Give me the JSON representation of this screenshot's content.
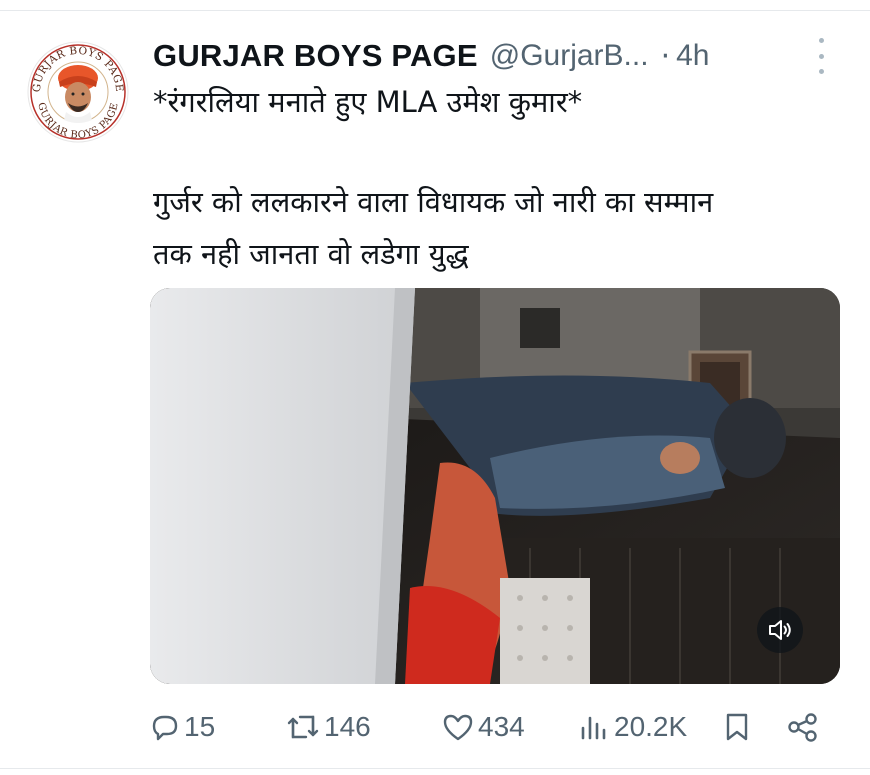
{
  "tweet": {
    "author_name": "GURJAR BOYS PAGE",
    "handle": "@GurjarB...",
    "separator": "·",
    "time": "4h",
    "line1": "*रंगरलिया मनाते हुए MLA उमेश कुमार*",
    "body_lines": [
      "गुर्जर को ललकारने वाला  विधायक जो नारी का सम्मान",
      "तक नही जानता वो लडेगा युद्ध"
    ]
  },
  "avatar": {
    "logo_text_top": "GURJAR BOYS PAGE",
    "logo_text_bottom": "GURJAR BOYS PAGE"
  },
  "media": {
    "type": "video",
    "mute_icon": "speaker-muted-icon"
  },
  "actions": {
    "replies": "15",
    "retweets": "146",
    "likes": "434",
    "views": "20.2K"
  },
  "colors": {
    "text_primary": "#0f1419",
    "text_secondary": "#536471",
    "divider": "#e6e9ec",
    "turban_orange": "#e8562a"
  }
}
